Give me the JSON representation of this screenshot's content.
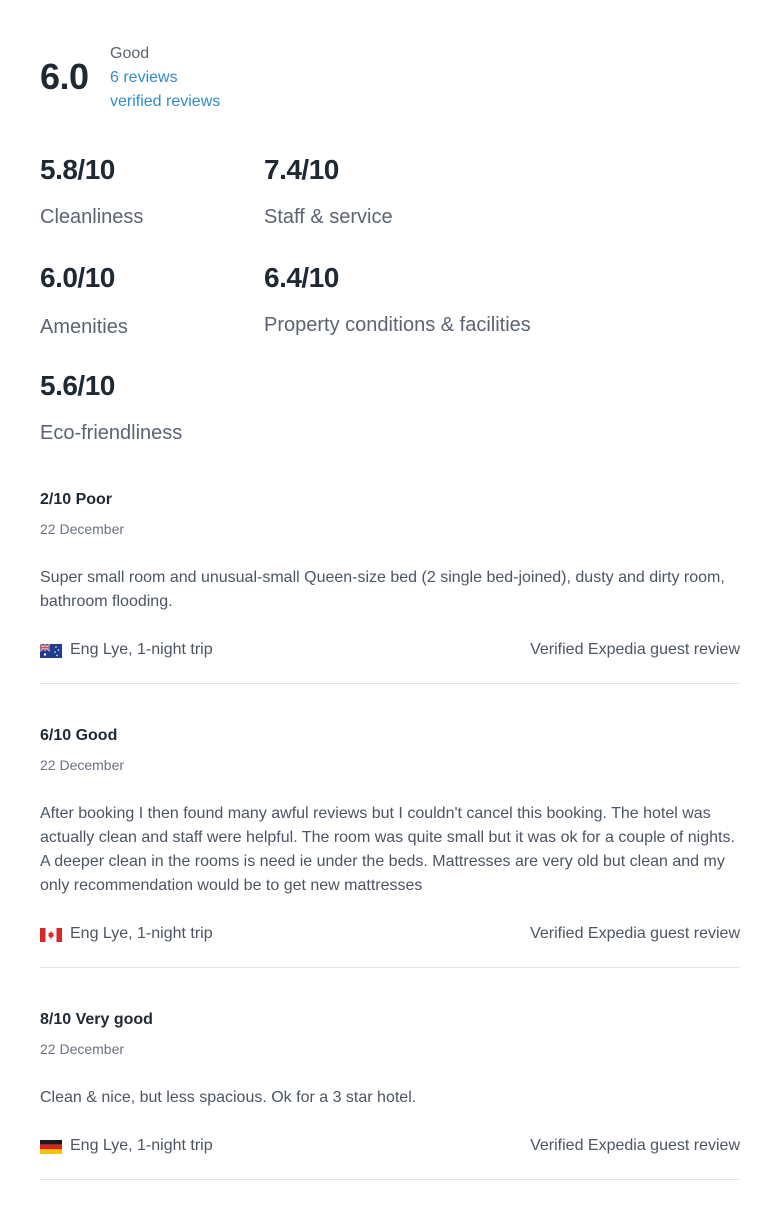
{
  "overall": {
    "score": "6.0",
    "label": "Good",
    "reviews_link": "6 reviews",
    "verified_link": "verified reviews"
  },
  "categories": [
    {
      "score": "5.8/10",
      "label": "Cleanliness"
    },
    {
      "score": "7.4/10",
      "label": "Staff & service"
    },
    {
      "score": "6.0/10",
      "label": "Amenities"
    },
    {
      "score": "6.4/10",
      "label": "Property conditions & facilities"
    },
    {
      "score": "5.6/10",
      "label": "Eco-friendliness"
    }
  ],
  "reviews": [
    {
      "rating": "2/10 Poor",
      "date": "22 December",
      "text": "Super small room and unusual-small Queen-size bed (2 single bed-joined), dusty and dirty room, bathroom flooding.",
      "flag_icon": "australia-flag-icon",
      "author": "Eng Lye, 1-night trip",
      "verified": "Verified Expedia guest review"
    },
    {
      "rating": "6/10 Good",
      "date": "22 December",
      "text": "After booking I then found many awful reviews but I couldn't cancel this booking. The hotel was actually clean and staff were helpful. The room was quite small but it was ok for a couple of nights. A deeper clean in the rooms is need ie under the beds. Mattresses are very old but clean and my only recommendation would be to get new mattresses",
      "flag_icon": "canada-flag-icon",
      "author": "Eng Lye, 1-night trip",
      "verified": "Verified Expedia guest review"
    },
    {
      "rating": "8/10 Very good",
      "date": "22 December",
      "text": "Clean & nice, but less spacious. Ok for a 3 star hotel.",
      "flag_icon": "germany-flag-icon",
      "author": "Eng Lye, 1-night trip",
      "verified": "Verified Expedia guest review"
    }
  ],
  "colors": {
    "link": "#2f8ccf",
    "text": "#1f2933",
    "muted": "#5b6470",
    "divider": "#e3e6ea"
  }
}
